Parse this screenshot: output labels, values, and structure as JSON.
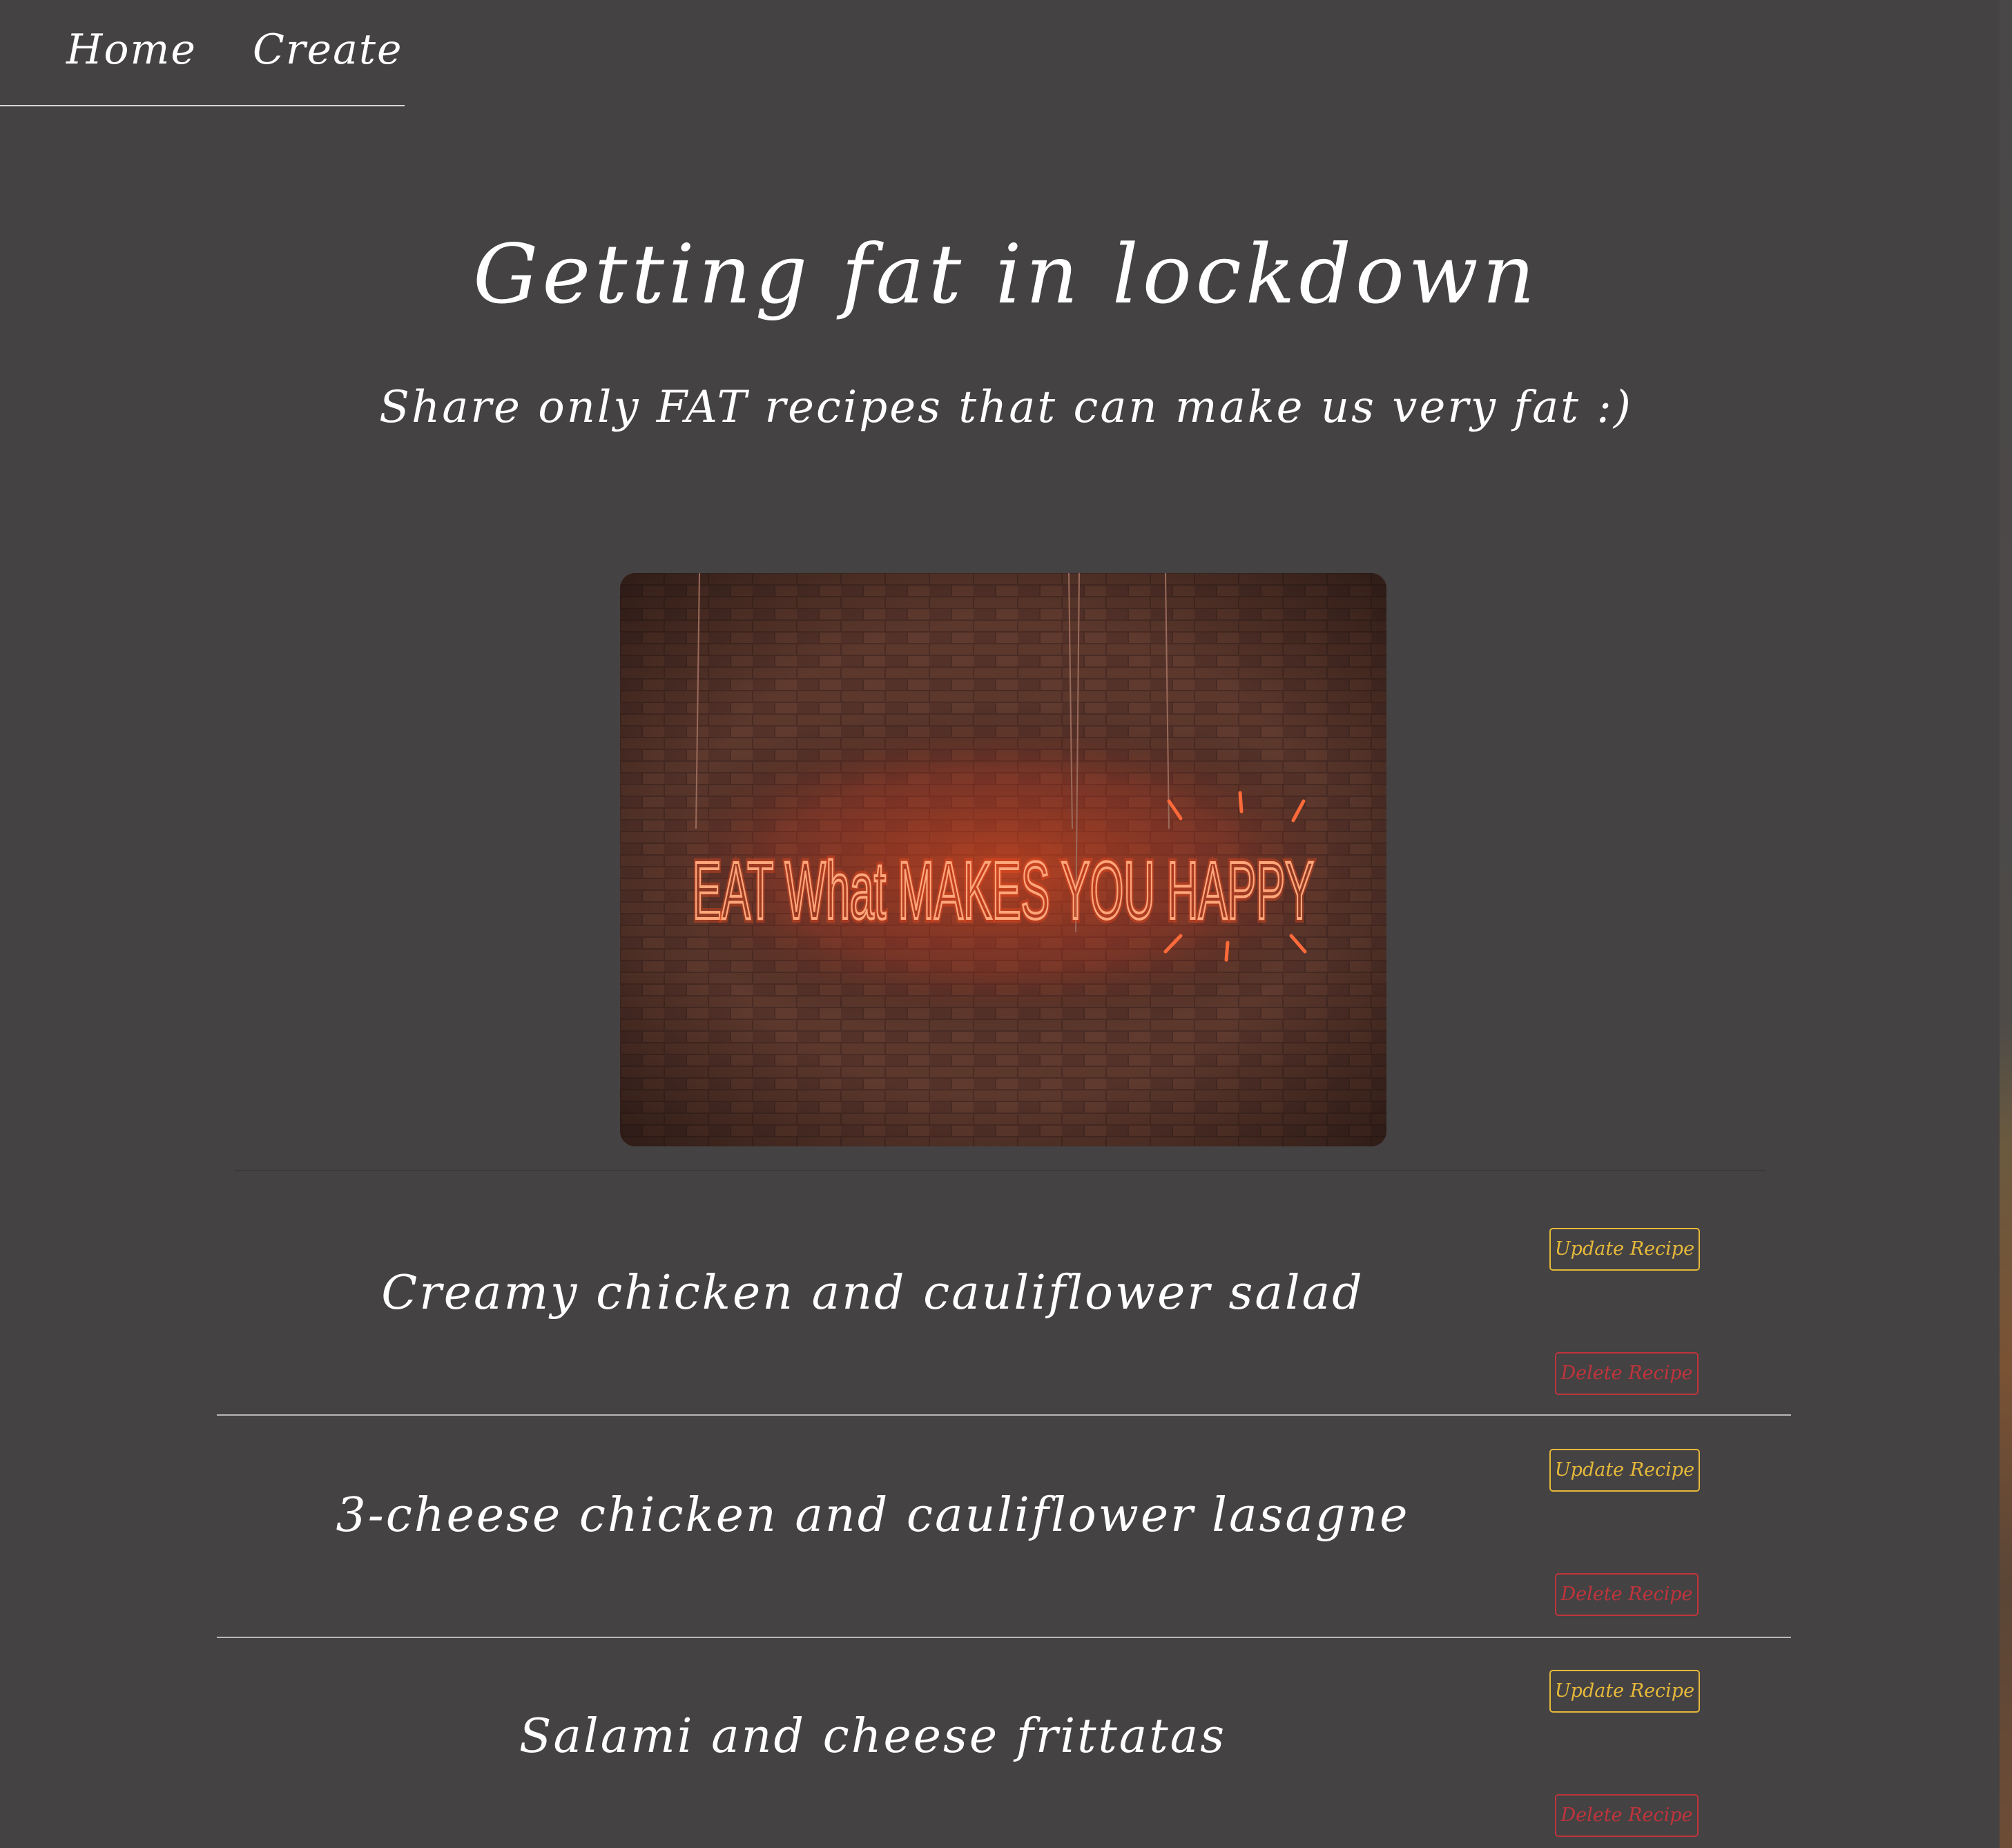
{
  "nav": {
    "home_label": "Home",
    "create_label": "Create"
  },
  "hero": {
    "title": "Getting fat in lockdown",
    "subtitle": "Share only FAT recipes that can make us very fat :)",
    "image_text": "EAT What MAKES YOU HAPPY"
  },
  "recipes": [
    {
      "title": "Creamy chicken and cauliflower salad",
      "update_label": "Update Recipe",
      "delete_label": "Delete Recipe"
    },
    {
      "title": "3-cheese chicken and cauliflower lasagne",
      "update_label": "Update Recipe",
      "delete_label": "Delete Recipe"
    },
    {
      "title": "Salami and cheese frittatas",
      "update_label": "Update Recipe",
      "delete_label": "Delete Recipe"
    }
  ],
  "colors": {
    "background": "#444243",
    "text": "#ffffff",
    "update_accent": "#e6b93a",
    "delete_accent": "#c0343c",
    "divider": "#b9b9b9",
    "neon": "#ff5a2a"
  }
}
